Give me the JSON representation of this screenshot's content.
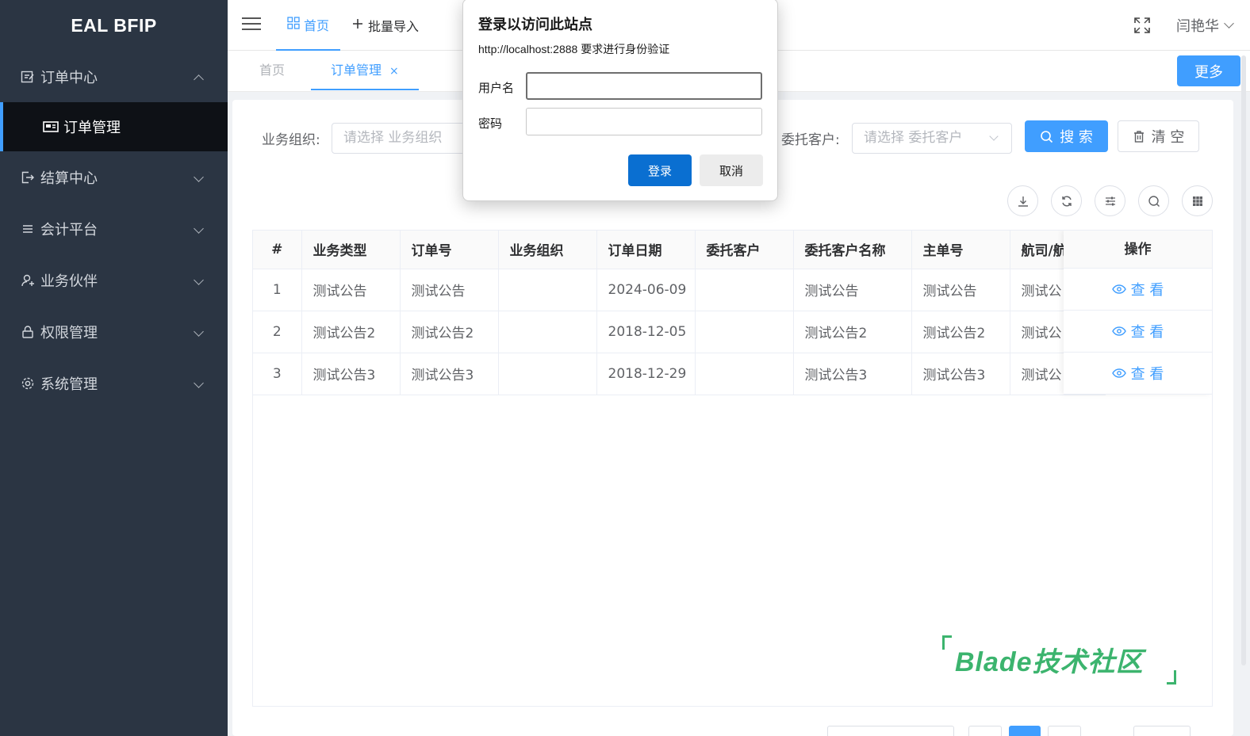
{
  "app": {
    "logo": "EAL BFIP"
  },
  "sidebar": {
    "items": [
      {
        "label": "订单中心",
        "icon": "edit-icon",
        "expanded": true,
        "children": [
          {
            "label": "订单管理",
            "icon": "monitor-icon",
            "active": true
          }
        ]
      },
      {
        "label": "结算中心",
        "icon": "logout-icon"
      },
      {
        "label": "会计平台",
        "icon": "menu-lines-icon"
      },
      {
        "label": "业务伙伴",
        "icon": "user-icon"
      },
      {
        "label": "权限管理",
        "icon": "lock-icon"
      },
      {
        "label": "系统管理",
        "icon": "gear-icon"
      }
    ]
  },
  "topbar": {
    "nav": [
      {
        "label": "首页",
        "icon": "grid-icon",
        "active": true
      },
      {
        "label": "批量导入",
        "icon": "plus-icon"
      }
    ],
    "user": "闫艳华"
  },
  "tags": {
    "items": [
      {
        "label": "首页"
      },
      {
        "label": "订单管理",
        "active": true,
        "close": "×"
      }
    ],
    "more": "更多"
  },
  "search_form": {
    "org_label": "业务组织:",
    "org_placeholder": "请选择 业务组织",
    "client_label": "委托客户:",
    "client_placeholder": "请选择 委托客户",
    "search_btn": "搜 索",
    "clear_btn": "清 空"
  },
  "table": {
    "columns": [
      "#",
      "业务类型",
      "订单号",
      "业务组织",
      "订单日期",
      "委托客户",
      "委托客户名称",
      "主单号",
      "航司/航",
      "操作"
    ],
    "rows": [
      {
        "idx": "1",
        "type": "测试公告",
        "order": "测试公告",
        "org": "",
        "date": "2024-06-09",
        "client": "",
        "client_name": "测试公告",
        "master": "测试公告",
        "airline": "测试公",
        "action": "查 看"
      },
      {
        "idx": "2",
        "type": "测试公告2",
        "order": "测试公告2",
        "org": "",
        "date": "2018-12-05",
        "client": "",
        "client_name": "测试公告2",
        "master": "测试公告2",
        "airline": "测试公",
        "action": "查 看"
      },
      {
        "idx": "3",
        "type": "测试公告3",
        "order": "测试公告3",
        "org": "",
        "date": "2018-12-29",
        "client": "",
        "client_name": "测试公告3",
        "master": "测试公告3",
        "airline": "测试公",
        "action": "查 看"
      }
    ]
  },
  "watermark": "Blade技术社区",
  "dialog": {
    "title": "登录以访问此站点",
    "message": "http://localhost:2888 要求进行身份验证",
    "username_label": "用户名",
    "password_label": "密码",
    "username_value": "",
    "password_value": "",
    "login": "登录",
    "cancel": "取消"
  },
  "colors": {
    "accent": "#409eff",
    "sidebar": "#2b3543",
    "dialog_primary": "#0a6fd1",
    "watermark": "#3cb46e"
  }
}
